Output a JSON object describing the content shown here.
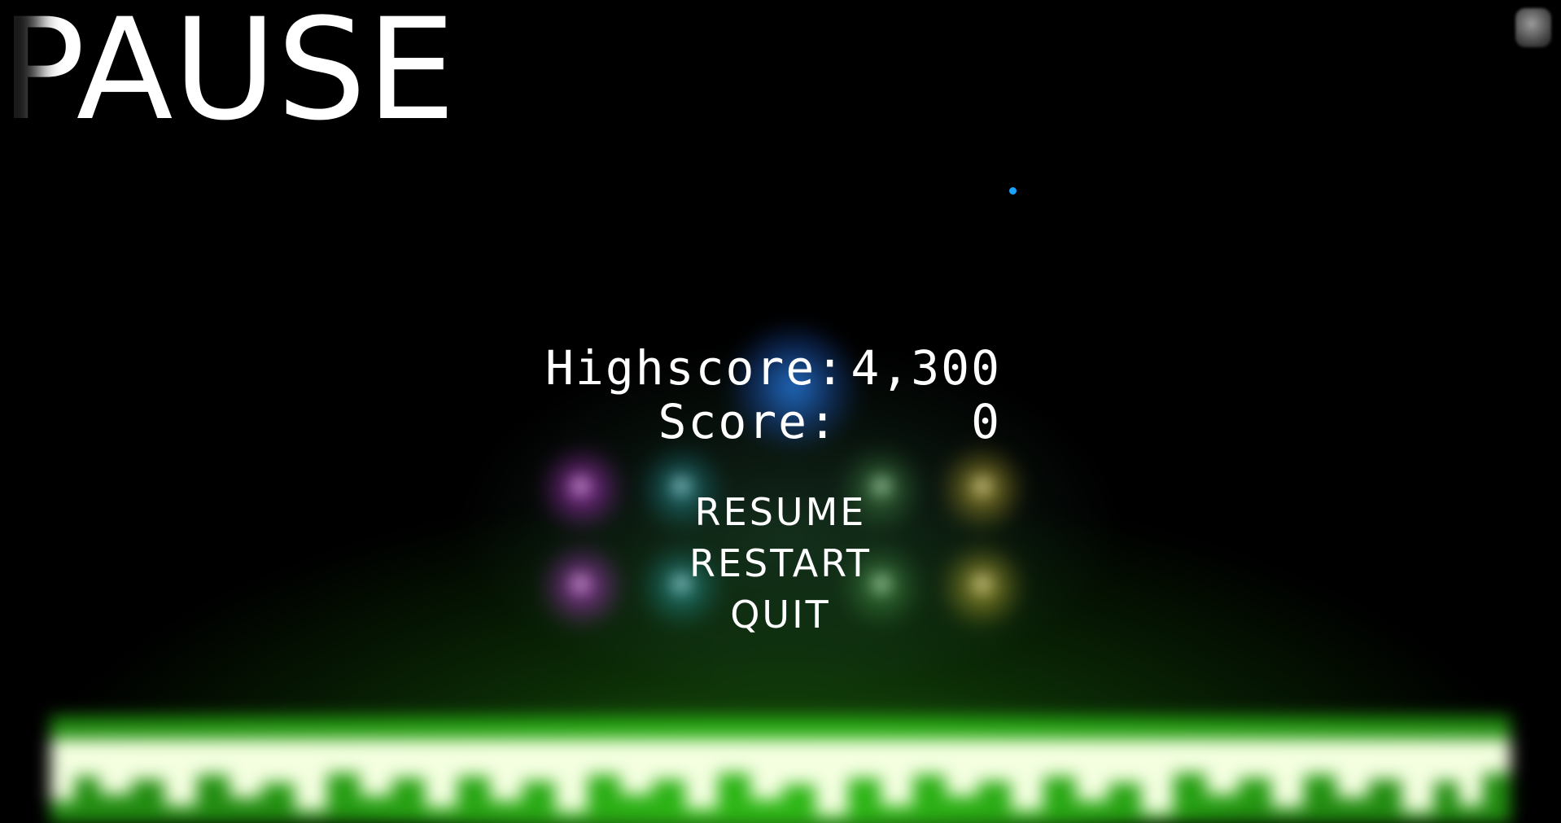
{
  "title": "PAUSE",
  "scores": {
    "highscore_label": "Highscore:",
    "highscore_value": "4,300",
    "score_label": "Score:",
    "score_value": "0"
  },
  "menu": {
    "resume": "RESUME",
    "restart": "RESTART",
    "quit": "QUIT"
  },
  "colors": {
    "background": "#000000",
    "text": "#ffffff",
    "equalizer_core": "#f4ffe0",
    "equalizer_glow": "#3cff1e",
    "orb_magenta": "#e040ff",
    "orb_cyan": "#30d8e8",
    "orb_green": "#7dff7d",
    "orb_yellow": "#ffe640",
    "orb_blue": "#2a8cff",
    "cursor": "#1aa3ff"
  },
  "icons": {
    "corner_button": "settings-icon"
  }
}
